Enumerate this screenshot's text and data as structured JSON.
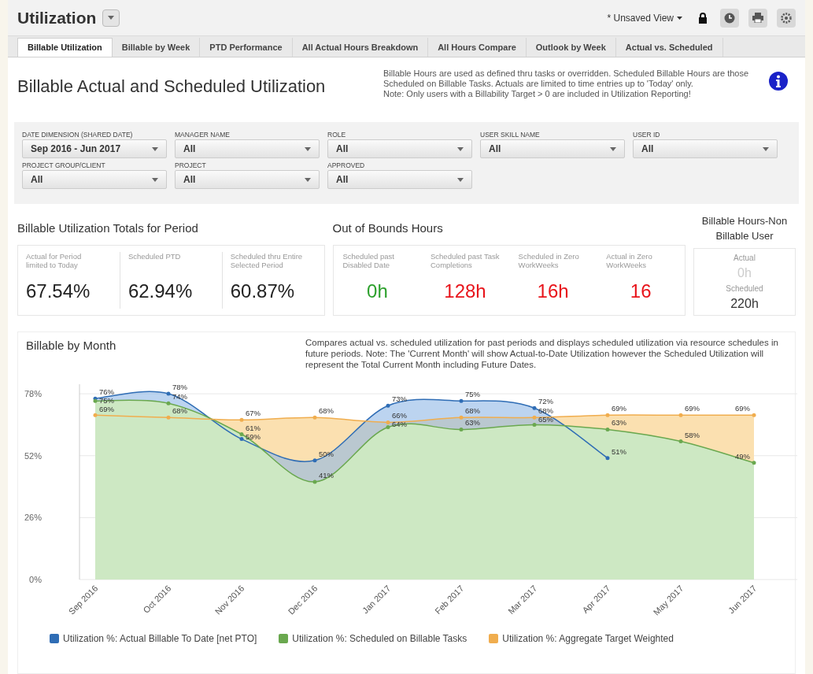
{
  "header": {
    "title": "Utilization",
    "view": "* Unsaved View"
  },
  "tabs": [
    {
      "label": "Billable Utilization",
      "selected": true
    },
    {
      "label": "Billable by Week",
      "selected": false
    },
    {
      "label": "PTD Performance",
      "selected": false
    },
    {
      "label": "All Actual Hours Breakdown",
      "selected": false
    },
    {
      "label": "All Hours Compare",
      "selected": false
    },
    {
      "label": "Outlook by Week",
      "selected": false
    },
    {
      "label": "Actual vs. Scheduled",
      "selected": false
    }
  ],
  "page": {
    "title": "Billable Actual and Scheduled Utilization",
    "note": "Billable Hours are used as defined thru tasks or overridden.  Scheduled Billable Hours are those Scheduled on Billable Tasks.  Actuals are limited to time entries up to 'Today' only.",
    "note_2": "Note: Only users with a Billability Target > 0 are included in Utilization Reporting!"
  },
  "filters": [
    {
      "label": "DATE DIMENSION (SHARED DATE)",
      "value": "Sep 2016 - Jun 2017"
    },
    {
      "label": "MANAGER NAME",
      "value": "All"
    },
    {
      "label": "ROLE",
      "value": "All"
    },
    {
      "label": "USER SKILL NAME",
      "value": "All"
    },
    {
      "label": "USER ID",
      "value": "All"
    },
    {
      "label": "PROJECT GROUP/CLIENT",
      "value": "All"
    },
    {
      "label": "PROJECT",
      "value": "All"
    },
    {
      "label": "APPROVED",
      "value": "All"
    }
  ],
  "totals": {
    "title": "Billable Utilization Totals for Period",
    "items": [
      {
        "label": "Actual for Period limited to Today",
        "value": "67.54%"
      },
      {
        "label": "Scheduled PTD",
        "value": "62.94%"
      },
      {
        "label": "Scheduled thru Entire Selected Period",
        "value": "60.87%"
      }
    ]
  },
  "out_of_bounds": {
    "title": "Out of Bounds Hours",
    "items": [
      {
        "label": "Scheduled past Disabled Date",
        "value": "0h",
        "color": "#2ca02c"
      },
      {
        "label": "Scheduled past Task Completions",
        "value": "128h",
        "color": "#e8141b"
      },
      {
        "label": "Scheduled in Zero WorkWeeks",
        "value": "16h",
        "color": "#e8141b"
      },
      {
        "label": "Actual in Zero WorkWeeks",
        "value": "16",
        "color": "#e8141b"
      }
    ]
  },
  "non_billable": {
    "title": "Billable Hours-Non Billable User",
    "actual_label": "Actual",
    "actual_value": "0h",
    "scheduled_label": "Scheduled",
    "scheduled_value": "220h"
  },
  "chart_section": {
    "title": "Billable by Month",
    "description": "Compares actual vs. scheduled utilization for past periods and displays scheduled utilization via resource schedules in future periods. Note: The 'Current Month' will show Actual-to-Date Utilization however the Scheduled Utilization will represent the Total Current Month including Future Dates.",
    "chart_data": {
      "type": "area",
      "grid": true,
      "categories": [
        "Sep 2016",
        "Oct 2016",
        "Nov 2016",
        "Dec 2016",
        "Jan 2017",
        "Feb 2017",
        "Mar 2017",
        "Apr 2017",
        "May 2017",
        "Jun 2017"
      ],
      "ylim": [
        0,
        82
      ],
      "yticks": [
        {
          "value": 0,
          "label": "0%"
        },
        {
          "value": 26,
          "label": "26%"
        },
        {
          "value": 52,
          "label": "52%"
        },
        {
          "value": 78,
          "label": "78%"
        }
      ],
      "series": [
        {
          "name": "Utilization %: Actual Billable To Date [net PTO]",
          "color": "#2f6db5",
          "values": [
            76,
            78,
            59,
            50,
            73,
            75,
            72,
            51,
            null,
            null
          ],
          "value_labels": [
            "76%",
            "78%",
            "59%",
            "50%",
            "73%",
            "75%",
            "72%",
            "51%",
            null,
            null
          ]
        },
        {
          "name": "Utilization %: Scheduled on Billable Tasks",
          "color": "#6aa84f",
          "values": [
            75,
            74,
            61,
            41,
            64,
            63,
            65,
            63,
            58,
            49
          ],
          "value_labels": [
            "75%",
            "74%",
            "61%",
            "41%",
            "64%",
            "63%",
            "65%",
            "63%",
            "58%",
            "49%"
          ]
        },
        {
          "name": "Utilization %: Aggregate Target Weighted",
          "color": "#f0ad4e",
          "values": [
            69,
            68,
            67,
            68,
            66,
            68,
            68,
            69,
            69,
            69
          ],
          "value_labels": [
            "69%",
            "68%",
            "67%",
            "68%",
            "66%",
            "68%",
            "68%",
            "69%",
            "69%",
            "69%"
          ]
        }
      ]
    }
  }
}
